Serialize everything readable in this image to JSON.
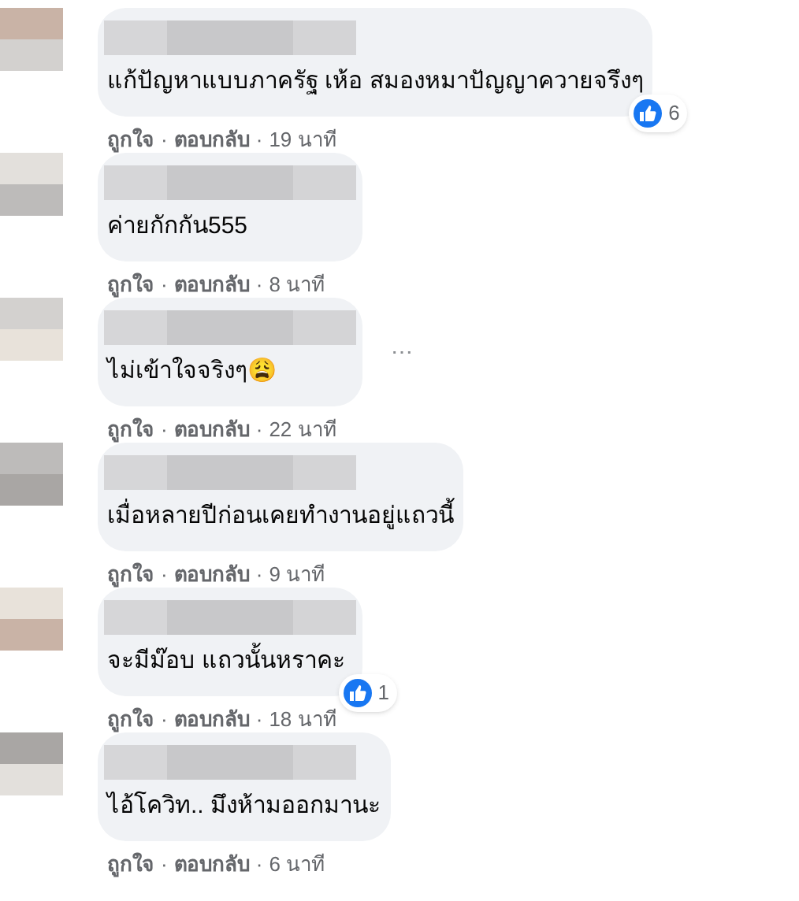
{
  "comments": [
    {
      "text": "แก้ปัญหาแบบภาครัฐ เห้อ สมองหมาปัญญาควายจรึงๆ",
      "reaction_count": "6",
      "like": "ถูกใจ",
      "dot_1": "·",
      "reply": "ตอบกลับ",
      "dot_2": "·",
      "time": "19 นาที"
    },
    {
      "text": "ค่ายกักกัน555",
      "like": "ถูกใจ",
      "dot_1": "·",
      "reply": "ตอบกลับ",
      "dot_2": "·",
      "time": "8 นาที"
    },
    {
      "text": "ไม่เข้าใจจริงๆ😩",
      "more_button": "⋯",
      "like": "ถูกใจ",
      "dot_1": "·",
      "reply": "ตอบกลับ",
      "dot_2": "·",
      "time": "22 นาที"
    },
    {
      "text": "เมื่อหลายปีก่อนเคยทำงานอยู่แถวนี้",
      "like": "ถูกใจ",
      "dot_1": "·",
      "reply": "ตอบกลับ",
      "dot_2": "·",
      "time": "9 นาที"
    },
    {
      "text": "จะมีม๊อบ แถวนั้นหราคะ",
      "reaction_count": "1",
      "like": "ถูกใจ",
      "dot_1": "·",
      "reply": "ตอบกลับ",
      "dot_2": "·",
      "time": "18 นาที"
    },
    {
      "text": "ไอ้โควิท.. มึงห้ามออกมานะ",
      "like": "ถูกใจ",
      "dot_1": "·",
      "reply": "ตอบกลับ",
      "dot_2": "·",
      "time": "6 นาที"
    }
  ]
}
